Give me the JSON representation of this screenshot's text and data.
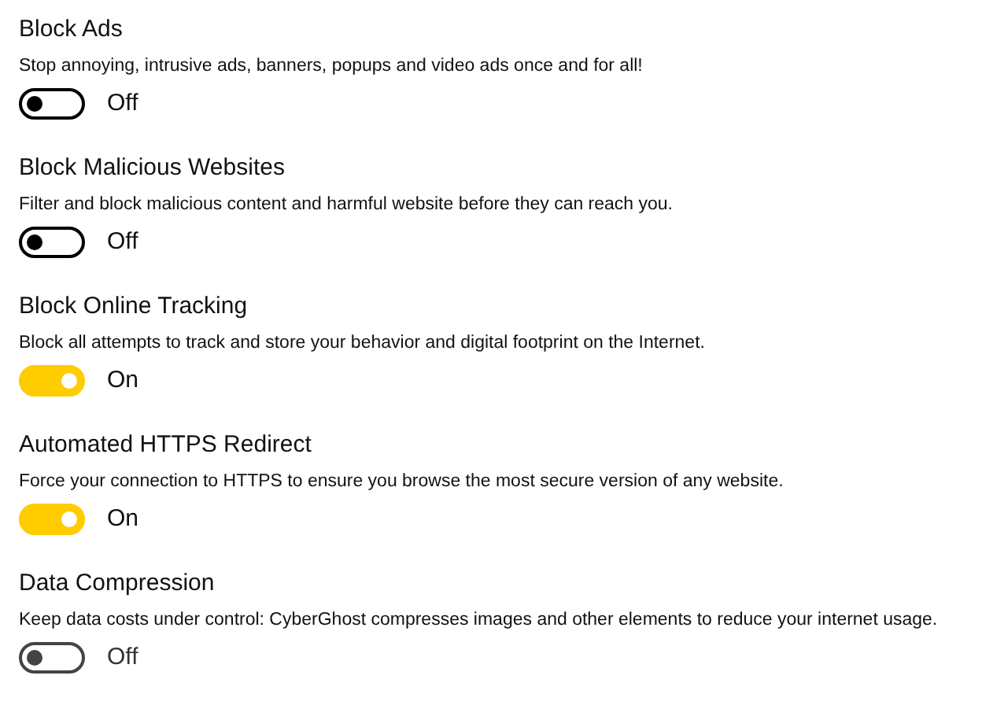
{
  "settings": [
    {
      "title": "Block Ads",
      "description": "Stop annoying, intrusive ads, banners, popups and video ads once and for all!",
      "on": false,
      "disabled": false,
      "state_label": "Off"
    },
    {
      "title": "Block Malicious Websites",
      "description": "Filter and block malicious content and harmful website before they can reach you.",
      "on": false,
      "disabled": false,
      "state_label": "Off"
    },
    {
      "title": "Block Online Tracking",
      "description": "Block all attempts to track and store your behavior and digital footprint on the Internet.",
      "on": true,
      "disabled": false,
      "state_label": "On"
    },
    {
      "title": "Automated HTTPS Redirect",
      "description": "Force your connection to HTTPS to ensure you browse the most secure version of any website.",
      "on": true,
      "disabled": false,
      "state_label": "On"
    },
    {
      "title": "Data Compression",
      "description": "Keep data costs under control: CyberGhost compresses images and other elements to reduce your internet usage.",
      "on": false,
      "disabled": true,
      "state_label": "Off"
    }
  ]
}
